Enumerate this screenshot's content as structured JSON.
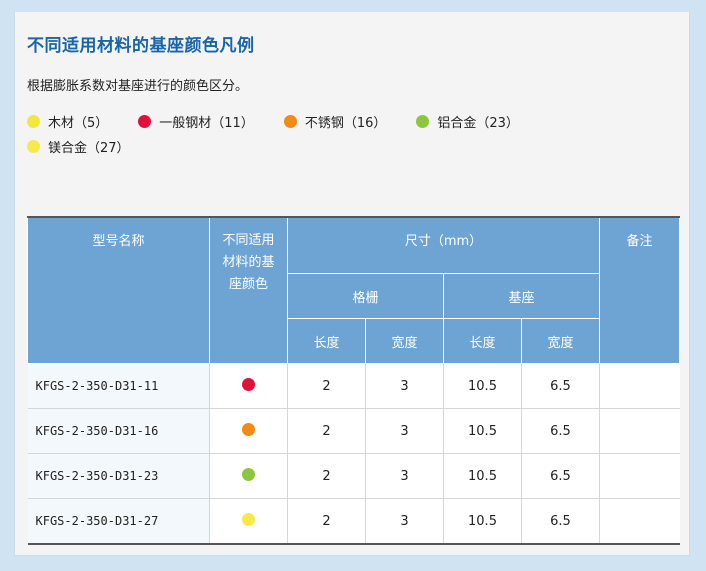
{
  "title": "不同适用材料的基座颜色凡例",
  "description": "根据膨胀系数对基座进行的颜色区分。",
  "legend": [
    {
      "label": "木材（5）",
      "color": "#f2e640"
    },
    {
      "label": "一般钢材（11）",
      "color": "#e0103a"
    },
    {
      "label": "不锈钢（16）",
      "color": "#f28a14"
    },
    {
      "label": "铝合金（23）",
      "color": "#8cc63f"
    },
    {
      "label": "镁合金（27）",
      "color": "#f5ea4a"
    }
  ],
  "table": {
    "headers": {
      "model": "型号名称",
      "color": "不同适用材料的基座颜色",
      "size": "尺寸（mm）",
      "grating": "格栅",
      "base": "基座",
      "length": "长度",
      "width": "宽度",
      "note": "备注"
    },
    "rows": [
      {
        "model": "KFGS-2-350-D31-11",
        "color": "#e0103a",
        "g_length": "2",
        "g_width": "3",
        "b_length": "10.5",
        "b_width": "6.5",
        "note": ""
      },
      {
        "model": "KFGS-2-350-D31-16",
        "color": "#f28a14",
        "g_length": "2",
        "g_width": "3",
        "b_length": "10.5",
        "b_width": "6.5",
        "note": ""
      },
      {
        "model": "KFGS-2-350-D31-23",
        "color": "#8cc63f",
        "g_length": "2",
        "g_width": "3",
        "b_length": "10.5",
        "b_width": "6.5",
        "note": ""
      },
      {
        "model": "KFGS-2-350-D31-27",
        "color": "#f5ea4a",
        "g_length": "2",
        "g_width": "3",
        "b_length": "10.5",
        "b_width": "6.5",
        "note": ""
      }
    ]
  }
}
